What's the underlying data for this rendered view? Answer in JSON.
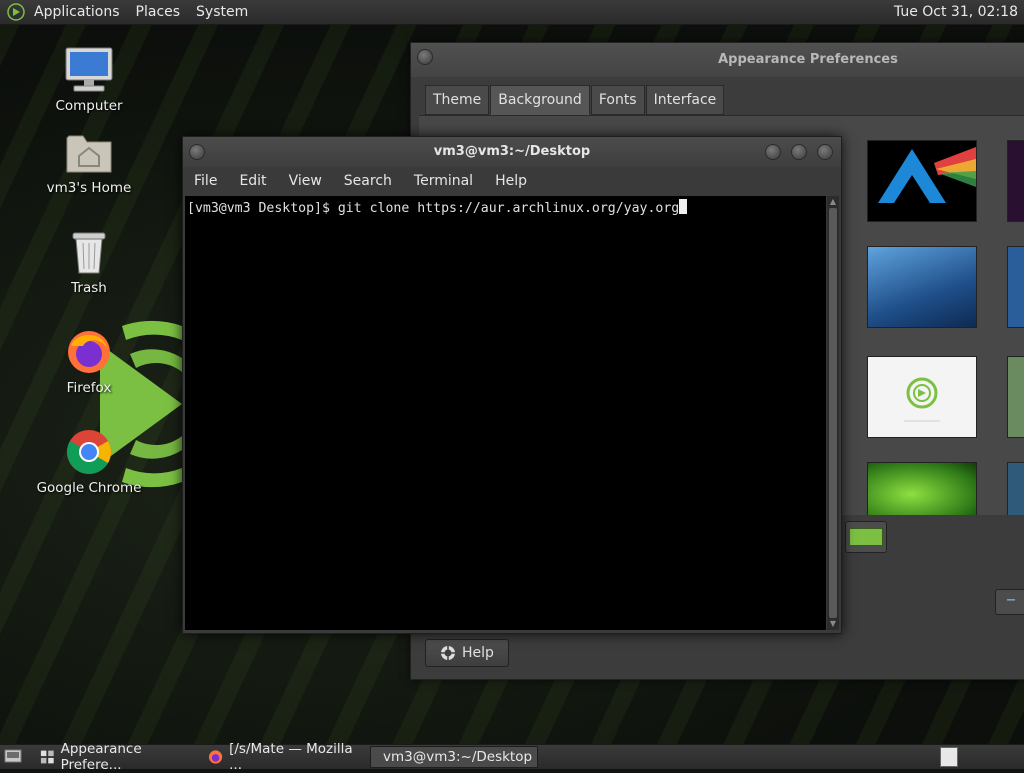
{
  "top_panel": {
    "menus": [
      "Applications",
      "Places",
      "System"
    ],
    "clock": "Tue Oct 31, 02:18"
  },
  "desktop": {
    "icons": [
      {
        "label": "Computer",
        "icon": "computer-icon"
      },
      {
        "label": "vm3's Home",
        "icon": "home-folder-icon"
      },
      {
        "label": "Trash",
        "icon": "trash-icon"
      },
      {
        "label": "Firefox",
        "icon": "firefox-icon"
      },
      {
        "label": "Google Chrome",
        "icon": "chrome-icon"
      }
    ]
  },
  "appearance": {
    "title": "Appearance Preferences",
    "tabs": [
      "Theme",
      "Background",
      "Fonts",
      "Interface"
    ],
    "active_tab": "Background",
    "help_label": "Help",
    "minus_label": "−",
    "colors": {
      "swatch": "#7bc043"
    }
  },
  "terminal": {
    "title": "vm3@vm3:~/Desktop",
    "menus": [
      "File",
      "Edit",
      "View",
      "Search",
      "Terminal",
      "Help"
    ],
    "line": "[vm3@vm3 Desktop]$ git clone https://aur.archlinux.org/yay.org"
  },
  "bottom_panel": {
    "tasks": [
      {
        "label": "Appearance Prefere...",
        "icon": "appearance-icon",
        "active": false
      },
      {
        "label": "[/s/Mate — Mozilla ...",
        "icon": "firefox-icon",
        "active": false
      },
      {
        "label": "vm3@vm3:~/Desktop",
        "icon": "terminal-icon",
        "active": true
      }
    ]
  }
}
